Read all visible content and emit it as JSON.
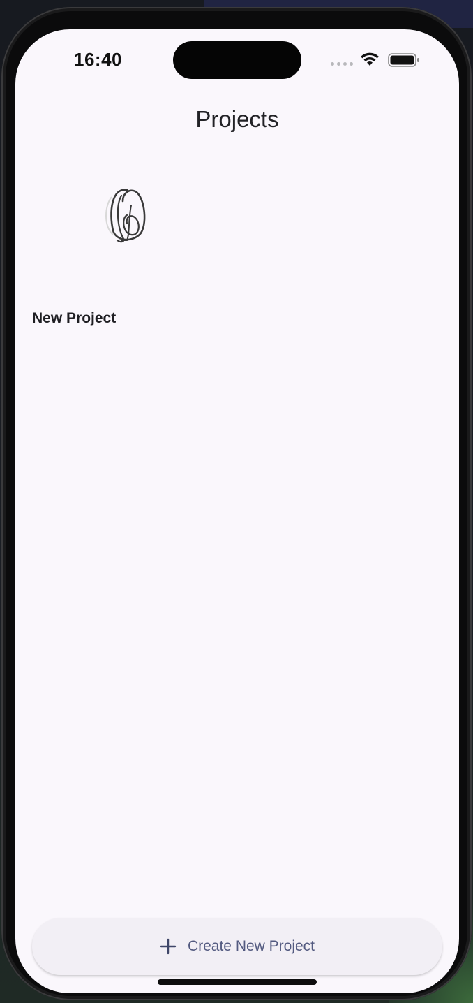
{
  "status_bar": {
    "time": "16:40"
  },
  "header": {
    "title": "Projects"
  },
  "projects": [
    {
      "name": "New Project",
      "thumbnail_icon": "sketch-thumbnail"
    }
  ],
  "actions": {
    "create_label": "Create New Project",
    "create_icon": "plus-icon"
  },
  "colors": {
    "screen_background": "#faf7fc",
    "button_background": "#f2eff5",
    "button_text": "#535a80"
  }
}
